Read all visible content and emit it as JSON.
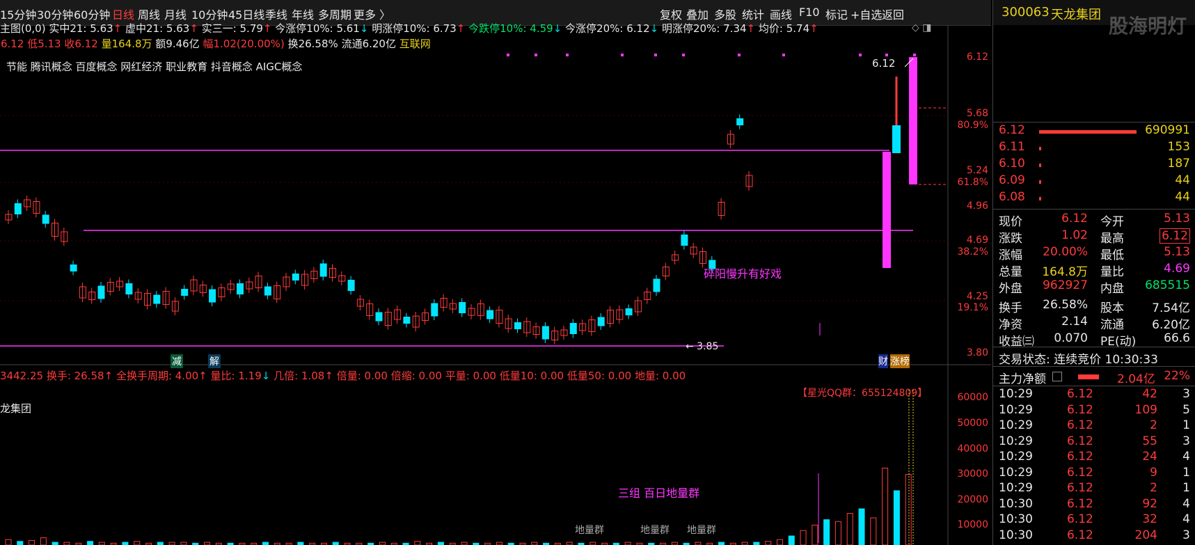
{
  "periods": [
    "15分钟",
    "30分钟",
    "60分钟",
    "日线",
    "周线",
    "月线",
    "10分钟",
    "45日线",
    "季线",
    "年线",
    "多周期",
    "更多 〉"
  ],
  "active_period": "日线",
  "tools": [
    "复权",
    "叠加",
    "多股",
    "统计",
    "画线",
    "F10",
    "标记",
    "+自选",
    "返回"
  ],
  "indicator_row1": {
    "main": "主图(0,0)",
    "shizhong": "实中21: 5.63",
    "xuzhong": "虚中21: 5.63",
    "shisanyi": "实三一: 5.79",
    "jinzhangting": "今涨停10%: 5.61",
    "mingzhangting": "明涨停10%: 6.73",
    "jindieting": "今跌停10%: 4.59",
    "jinzhangting20": "今涨停20%: 6.12",
    "mingzhangting20": "明涨停20%: 7.34",
    "junjia": "均价: 5.74"
  },
  "indicator_row2": {
    "high": "高6.12",
    "low": "低5.13",
    "close": "收6.12",
    "volume": "量164.8万",
    "amount": "额9.46亿",
    "change": "幅1.02(20.00%)",
    "turnover": "换26.58%",
    "float": "流通6.20亿",
    "sector": "互联网"
  },
  "concepts": "节能 腾讯概念 百度概念 网红经济 职业教育 抖音概念 AIGC概念",
  "chart_annotations": {
    "slow_rise": "碎阳慢升有好戏",
    "low_price": "← 3.85",
    "high_price": "6.12",
    "jian": "减",
    "jie": "解",
    "cai": "财",
    "zhangbang": "涨榜",
    "volume_group": "三组  百日地量群",
    "qq_group": "【星光QQ群：655124809】",
    "diliang": "地量群"
  },
  "price_axis": [
    "6.12",
    "5.68",
    "5.24",
    "4.96",
    "4.69",
    "4.25",
    "3.80"
  ],
  "pct_axis": [
    "80.9%",
    "61.8%",
    "38.2%",
    "19.1%"
  ],
  "vol_axis": [
    "60000",
    "50000",
    "40000",
    "30000",
    "20000",
    "10000"
  ],
  "sub_indicator": {
    "label": "3442.25",
    "huanshou": "换手: 26.58",
    "quanhuan": "全换手周期: 4.00",
    "liangbi": "量比: 1.19",
    "jibei": "几倍: 1.08",
    "beiliang": "倍量: 0.00",
    "beisuo": "倍缩: 0.00",
    "pingliang": "平量: 0.00",
    "diliang10": "低量10: 0.00",
    "diliang50": "低量50: 0.00",
    "diliang": "地量: 0.00"
  },
  "sub_title": "龙集团",
  "stock": {
    "code": "300063",
    "name": "天龙集团",
    "watermark": "股海明灯"
  },
  "orderbook": [
    {
      "price": "6.12",
      "vol": "690991"
    },
    {
      "price": "6.11",
      "vol": "153"
    },
    {
      "price": "6.10",
      "vol": "187"
    },
    {
      "price": "6.09",
      "vol": "44"
    },
    {
      "price": "6.08",
      "vol": "44"
    }
  ],
  "quote": {
    "xianjia_l": "现价",
    "xianjia": "6.12",
    "jinkai_l": "今开",
    "jinkai": "5.13",
    "zhangdie_l": "涨跌",
    "zhangdie": "1.02",
    "zuigao_l": "最高",
    "zuigao": "6.12",
    "zhangfu_l": "涨幅",
    "zhangfu": "20.00%",
    "zuidi_l": "最低",
    "zuidi": "5.13",
    "zongliang_l": "总量",
    "zongliang": "164.8万",
    "liangbi_l": "量比",
    "liangbi": "4.69",
    "waipan_l": "外盘",
    "waipan": "962927",
    "neipan_l": "内盘",
    "neipan": "685515",
    "huanshou_l": "换手",
    "huanshou": "26.58%",
    "guben_l": "股本",
    "guben": "7.54亿",
    "jingzi_l": "净资",
    "jingzi": "2.14",
    "liutong_l": "流通",
    "liutong": "6.20亿",
    "shouyi_l": "收益㈢",
    "shouyi": "0.070",
    "pe_l": "PE(动)",
    "pe": "66.6"
  },
  "trade_status": "交易状态: 连续竞价 10:30:33",
  "main_flow": {
    "label": "主力净额",
    "value": "2.04亿",
    "pct": "22%"
  },
  "ticks": [
    {
      "t": "10:29",
      "p": "6.12",
      "v": "42",
      "n": "3"
    },
    {
      "t": "10:29",
      "p": "6.12",
      "v": "109",
      "n": "5"
    },
    {
      "t": "10:29",
      "p": "6.12",
      "v": "2",
      "n": "1"
    },
    {
      "t": "10:29",
      "p": "6.12",
      "v": "55",
      "n": "3"
    },
    {
      "t": "10:29",
      "p": "6.12",
      "v": "24",
      "n": "4"
    },
    {
      "t": "10:29",
      "p": "6.12",
      "v": "9",
      "n": "1"
    },
    {
      "t": "10:29",
      "p": "6.12",
      "v": "2",
      "n": "1"
    },
    {
      "t": "10:30",
      "p": "6.12",
      "v": "92",
      "n": "4"
    },
    {
      "t": "10:30",
      "p": "6.12",
      "v": "32",
      "n": "4"
    },
    {
      "t": "10:30",
      "p": "6.12",
      "v": "204",
      "n": "3"
    }
  ],
  "colors": {
    "up": "#ff3b3b",
    "down": "#00e5ff",
    "magenta": "#ff36ff",
    "yellow": "#e8d21a",
    "green": "#00e36a"
  }
}
